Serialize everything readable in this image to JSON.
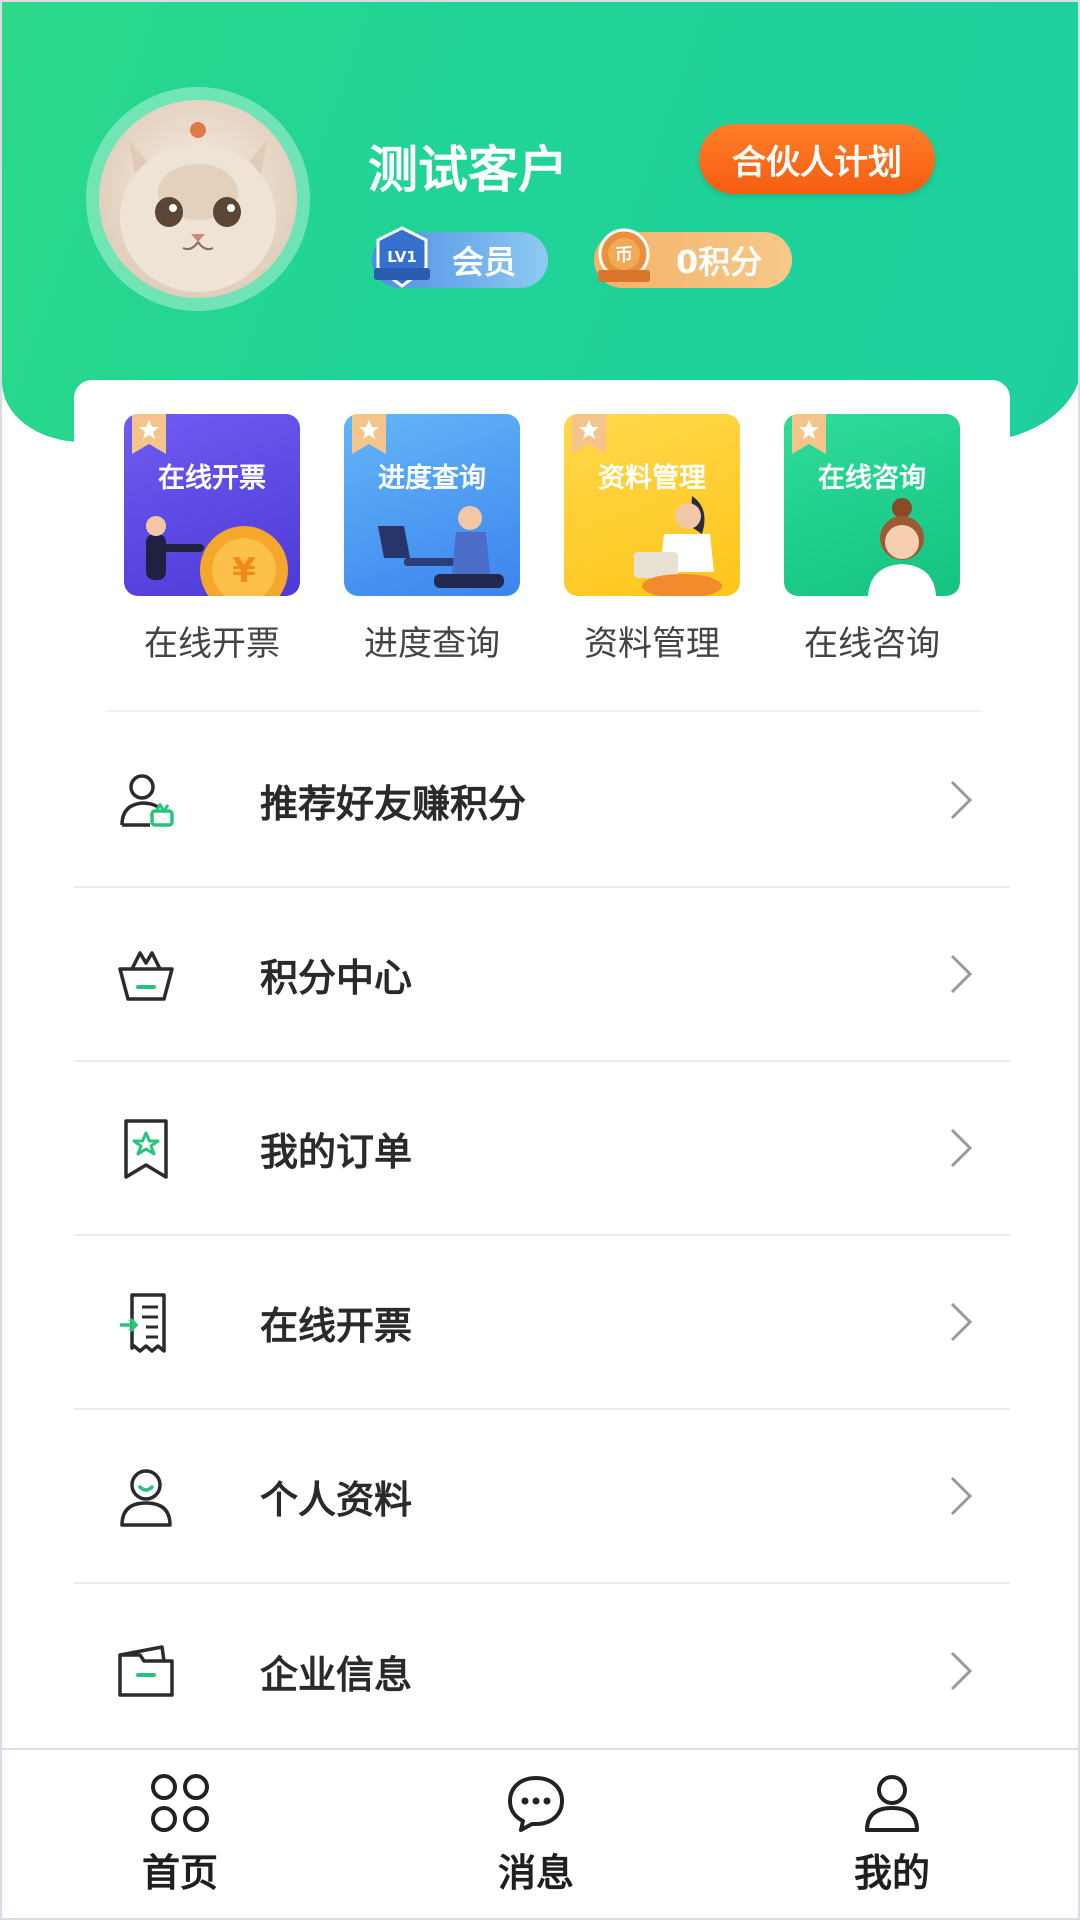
{
  "profile": {
    "name": "测试客户",
    "partner_button": "合伙人计划",
    "member_label": "会员",
    "member_badge_text": "LV1",
    "points_label": "0积分",
    "points_badge_text": "币"
  },
  "quick": [
    {
      "tile_title": "在线开票",
      "label": "在线开票"
    },
    {
      "tile_title": "进度查询",
      "label": "进度查询"
    },
    {
      "tile_title": "资料管理",
      "label": "资料管理"
    },
    {
      "tile_title": "在线咨询",
      "label": "在线咨询"
    }
  ],
  "menu": [
    {
      "label": "推荐好友赚积分",
      "icon": "user-refer-icon"
    },
    {
      "label": "积分中心",
      "icon": "basket-icon"
    },
    {
      "label": "我的订单",
      "icon": "bookmark-star-icon"
    },
    {
      "label": "在线开票",
      "icon": "invoice-icon"
    },
    {
      "label": "个人资料",
      "icon": "person-icon"
    },
    {
      "label": "企业信息",
      "icon": "folder-icon"
    }
  ],
  "tabs": [
    {
      "label": "首页",
      "icon": "grid-icon"
    },
    {
      "label": "消息",
      "icon": "chat-icon"
    },
    {
      "label": "我的",
      "icon": "user-icon"
    }
  ],
  "colors": {
    "header_green": "#20d496",
    "partner_orange": "#f55d10",
    "icon_green": "#27c47b"
  }
}
